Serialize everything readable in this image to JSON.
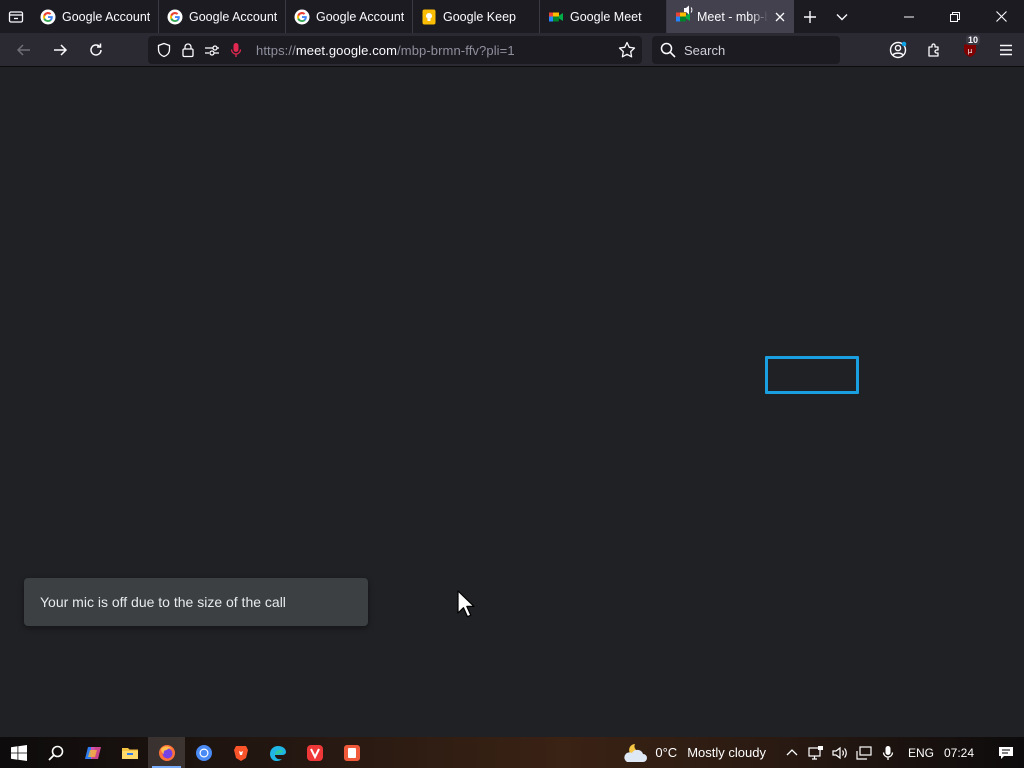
{
  "browser": {
    "tabs": [
      {
        "title": "Google Account",
        "icon": "google-g-icon",
        "active": false
      },
      {
        "title": "Google Account",
        "icon": "google-g-icon",
        "active": false
      },
      {
        "title": "Google Account",
        "icon": "google-g-icon",
        "active": false
      },
      {
        "title": "Google Keep",
        "icon": "google-keep-icon",
        "active": false
      },
      {
        "title": "Google Meet",
        "icon": "google-meet-icon",
        "active": false
      },
      {
        "title": "Meet - mbp-brmn-ffv",
        "icon": "google-meet-icon",
        "active": true,
        "playing_audio": true
      }
    ],
    "url": {
      "scheme": "https://",
      "host": "meet.google.com",
      "path": "/mbp-brmn-ffv?pli=1"
    },
    "search_placeholder": "Search",
    "extension_badge": "10"
  },
  "page": {
    "toast_message": "Your mic is off due to the size of the call"
  },
  "taskbar": {
    "apps": [
      "windows-start-icon",
      "search-icon",
      "copilot-icon",
      "file-explorer-icon",
      "firefox-icon",
      "chrome-icon",
      "brave-icon",
      "edge-icon",
      "vivaldi-icon",
      "app-icon"
    ],
    "weather_temp": "0°C",
    "weather_desc": "Mostly cloudy",
    "language": "ENG",
    "time": "07:24"
  },
  "colors": {
    "page_bg": "#202124",
    "focus_ring": "#1a9fe0",
    "toast_bg": "#3c4043"
  }
}
